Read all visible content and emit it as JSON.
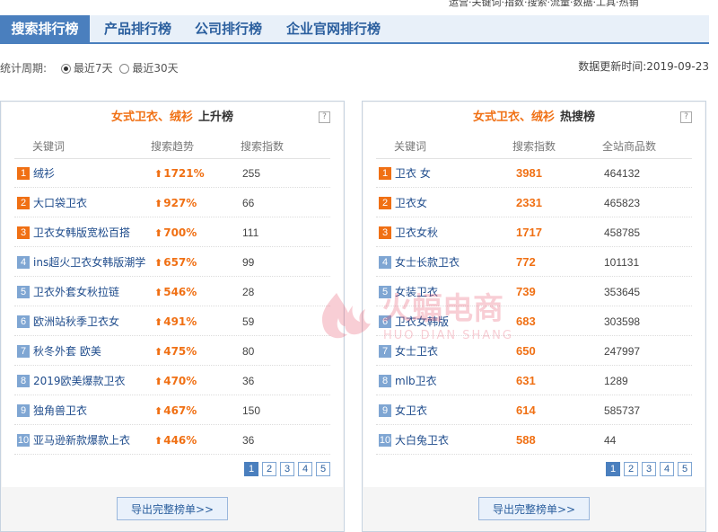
{
  "top_notice": "运营·关键词·指数·搜索·流量·数据·工具·热销",
  "tabs": [
    "搜索排行榜",
    "产品排行榜",
    "公司排行榜",
    "企业官网排行榜"
  ],
  "period": {
    "label": "统计周期:",
    "options": [
      "最近7天",
      "最近30天"
    ],
    "selected": "最近7天"
  },
  "update": {
    "label": "数据更新时间:",
    "date": "2019-09-23"
  },
  "rising": {
    "keyword": "女式卫衣、绒衫",
    "tag": "上升榜",
    "headers": [
      "关键词",
      "搜索趋势",
      "搜索指数"
    ],
    "rows": [
      {
        "rank": "1",
        "keyword": "绒衫",
        "trend": "1721%",
        "index": "255"
      },
      {
        "rank": "2",
        "keyword": "大口袋卫衣",
        "trend": "927%",
        "index": "66"
      },
      {
        "rank": "3",
        "keyword": "卫衣女韩版宽松百搭",
        "trend": "700%",
        "index": "111"
      },
      {
        "rank": "4",
        "keyword": "ins超火卫衣女韩版潮学",
        "trend": "657%",
        "index": "99"
      },
      {
        "rank": "5",
        "keyword": "卫衣外套女秋拉链",
        "trend": "546%",
        "index": "28"
      },
      {
        "rank": "6",
        "keyword": "欧洲站秋季卫衣女",
        "trend": "491%",
        "index": "59"
      },
      {
        "rank": "7",
        "keyword": "秋冬外套 欧美",
        "trend": "475%",
        "index": "80"
      },
      {
        "rank": "8",
        "keyword": "2019欧美爆款卫衣",
        "trend": "470%",
        "index": "36"
      },
      {
        "rank": "9",
        "keyword": "独角兽卫衣",
        "trend": "467%",
        "index": "150"
      },
      {
        "rank": "10",
        "keyword": "亚马逊新款爆款上衣",
        "trend": "446%",
        "index": "36"
      }
    ],
    "pages": [
      "1",
      "2",
      "3",
      "4",
      "5"
    ],
    "export_label": "导出完整榜单>>"
  },
  "hot": {
    "keyword": "女式卫衣、绒衫",
    "tag": "热搜榜",
    "headers": [
      "关键词",
      "搜索指数",
      "全站商品数"
    ],
    "rows": [
      {
        "rank": "1",
        "keyword": "卫衣 女",
        "index": "3981",
        "products": "464132"
      },
      {
        "rank": "2",
        "keyword": "卫衣女",
        "index": "2331",
        "products": "465823"
      },
      {
        "rank": "3",
        "keyword": "卫衣女秋",
        "index": "1717",
        "products": "458785"
      },
      {
        "rank": "4",
        "keyword": "女士长款卫衣",
        "index": "772",
        "products": "101131"
      },
      {
        "rank": "5",
        "keyword": "女装卫衣",
        "index": "739",
        "products": "353645"
      },
      {
        "rank": "6",
        "keyword": "卫衣女韩版",
        "index": "683",
        "products": "303598"
      },
      {
        "rank": "7",
        "keyword": "女士卫衣",
        "index": "650",
        "products": "247997"
      },
      {
        "rank": "8",
        "keyword": "mlb卫衣",
        "index": "631",
        "products": "1289"
      },
      {
        "rank": "9",
        "keyword": "女卫衣",
        "index": "614",
        "products": "585737"
      },
      {
        "rank": "10",
        "keyword": "大白兔卫衣",
        "index": "588",
        "products": "44"
      }
    ],
    "pages": [
      "1",
      "2",
      "3",
      "4",
      "5"
    ],
    "export_label": "导出完整榜单>>"
  },
  "watermark": {
    "text_cn": "火蝠电商",
    "text_en": "HUO DIAN SHANG",
    "color": "#e8526a"
  },
  "colors": {
    "accent": "#4a7fbe",
    "highlight": "#f07014",
    "rank_cold": "#7fa6d3"
  }
}
